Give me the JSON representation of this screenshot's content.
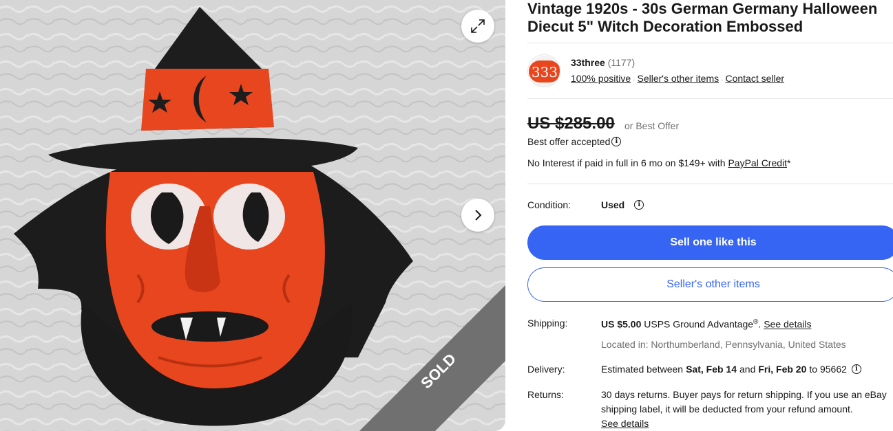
{
  "gallery": {
    "sold_label": "SOLD",
    "expand_icon": "expand-icon",
    "next_icon": "chevron-right-icon"
  },
  "listing": {
    "title_line1": "Vintage 1920s - 30s German Germany Halloween",
    "title_line2": "Diecut 5\" Witch Decoration Embossed"
  },
  "seller": {
    "avatar_text": "333",
    "name": "33three",
    "feedback_count": "(1177)",
    "positive": "100% positive",
    "other_items_link": "Seller's other items",
    "contact_link": "Contact seller",
    "separator": "·"
  },
  "price": {
    "amount": "US $285.00",
    "best_offer": "or Best Offer",
    "offer_status": "Best offer accepted",
    "financing_text": "No Interest if paid in full in 6 mo on $149+ with",
    "financing_link": "PayPal Credit",
    "financing_suffix": "*"
  },
  "condition": {
    "label": "Condition:",
    "value": "Used"
  },
  "buttons": {
    "sell_one": "Sell one like this",
    "seller_other_items": "Seller's other items"
  },
  "shipping": {
    "label": "Shipping:",
    "price": "US $5.00",
    "service": "USPS Ground Advantage",
    "reg": "®",
    "details_link": "See details",
    "location_label": "Located in:",
    "location": "Northumberland, Pennsylvania, United States"
  },
  "delivery": {
    "label": "Delivery:",
    "prefix": "Estimated between",
    "start": "Sat, Feb 14",
    "and": "and",
    "end": "Fri, Feb 20",
    "to": "to 95662"
  },
  "returns": {
    "label": "Returns:",
    "line1": "30 days returns. Buyer pays for return shipping. If you use an eBay",
    "line2": "shipping label, it will be deducted from your refund amount.",
    "details_link": "See details"
  },
  "colors": {
    "accent": "#3665f3",
    "text": "#191919",
    "muted": "#707070",
    "ribbon": "#707070"
  }
}
